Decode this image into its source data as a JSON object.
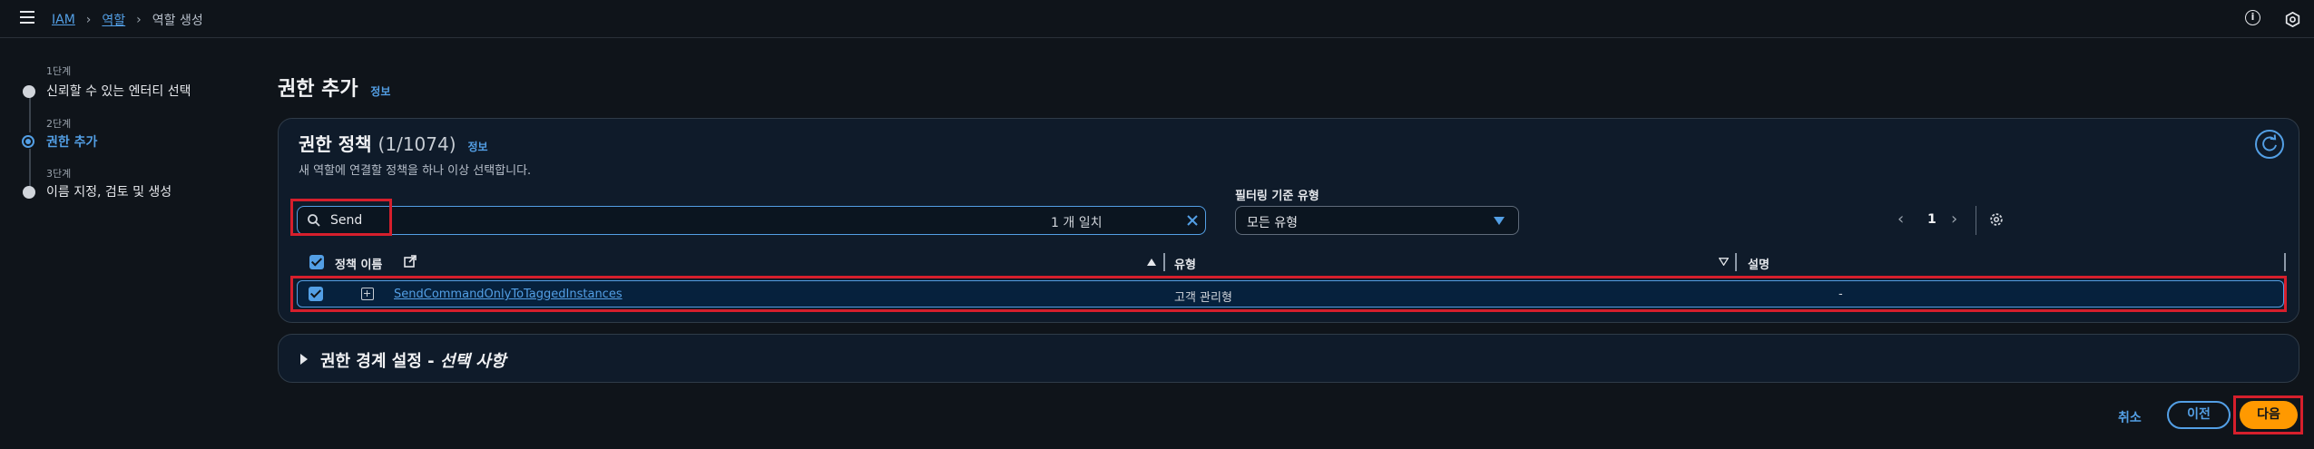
{
  "breadcrumb": {
    "items": [
      "IAM",
      "역할"
    ],
    "current": "역할 생성"
  },
  "steps": [
    {
      "num": "1단계",
      "label": "신뢰할 수 있는 엔터티 선택",
      "state": "done"
    },
    {
      "num": "2단계",
      "label": "권한 추가",
      "state": "active"
    },
    {
      "num": "3단계",
      "label": "이름 지정, 검토 및 생성",
      "state": "pending"
    }
  ],
  "page": {
    "title": "권한 추가",
    "info": "정보"
  },
  "policies": {
    "title": "권한 정책",
    "count": "(1/1074)",
    "info": "정보",
    "description": "새 역할에 연결할 정책을 하나 이상 선택합니다.",
    "filter_label": "필터링 기준 유형",
    "search_value": "Send",
    "type_selected": "모든 유형",
    "match_count": "1 개 일치",
    "page_number": "1",
    "columns": [
      "정책 이름",
      "유형",
      "설명"
    ],
    "rows": [
      {
        "name": "SendCommandOnlyToTaggedInstances",
        "type": "고객 관리형",
        "description": "-",
        "checked": true
      }
    ]
  },
  "boundary": {
    "title": "권한 경계 설정 - ",
    "optional": "선택 사항"
  },
  "footer": {
    "cancel": "취소",
    "previous": "이전",
    "next": "다음"
  },
  "colors": {
    "background": "#0f141a",
    "accent": "#539fe5",
    "primary_button": "#ff9900",
    "highlight": "#d61f2c"
  },
  "icons": [
    "menu-icon",
    "info-icon",
    "settings-icon",
    "refresh-icon",
    "search-icon",
    "clear-icon",
    "caret-down-icon",
    "chevron-left-icon",
    "chevron-right-icon",
    "external-link-icon",
    "sort-ascending-icon",
    "expand-icon",
    "caret-right-icon"
  ]
}
